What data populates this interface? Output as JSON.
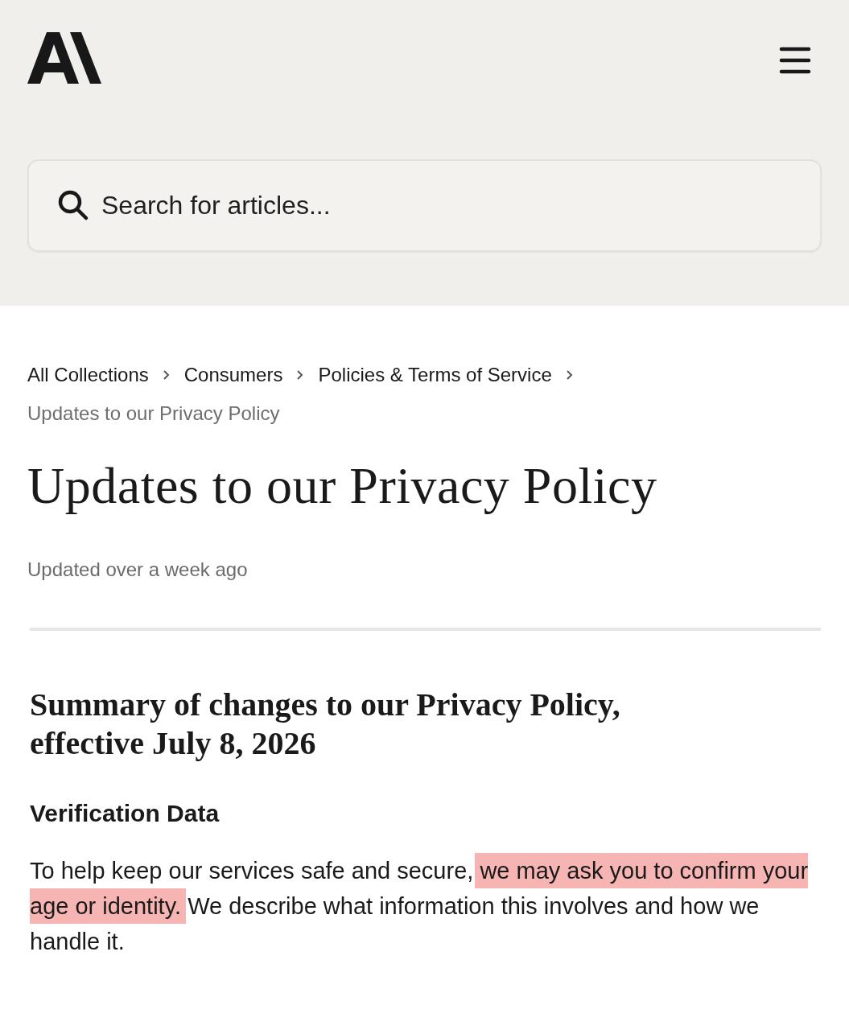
{
  "header": {
    "search": {
      "placeholder": "Search for articles..."
    }
  },
  "breadcrumb": [
    {
      "label": "All Collections",
      "current": false
    },
    {
      "label": "Consumers",
      "current": false
    },
    {
      "label": "Policies & Terms of Service",
      "current": false
    },
    {
      "label": "Updates to our Privacy Policy",
      "current": true
    }
  ],
  "article": {
    "title": "Updates to our Privacy Policy",
    "updated": "Updated over a week ago",
    "heading": "Summary of changes to our Privacy Policy, effective July 8, 2026",
    "subheading": "Verification Data",
    "paragraph": [
      {
        "text": "To help keep our services safe and secure, ",
        "highlighted": false
      },
      {
        "text": "we may ask you to confirm your age or identity.",
        "highlighted": true
      },
      {
        "text": " We describe what information this involves and how we handle it.",
        "highlighted": false
      }
    ]
  }
}
